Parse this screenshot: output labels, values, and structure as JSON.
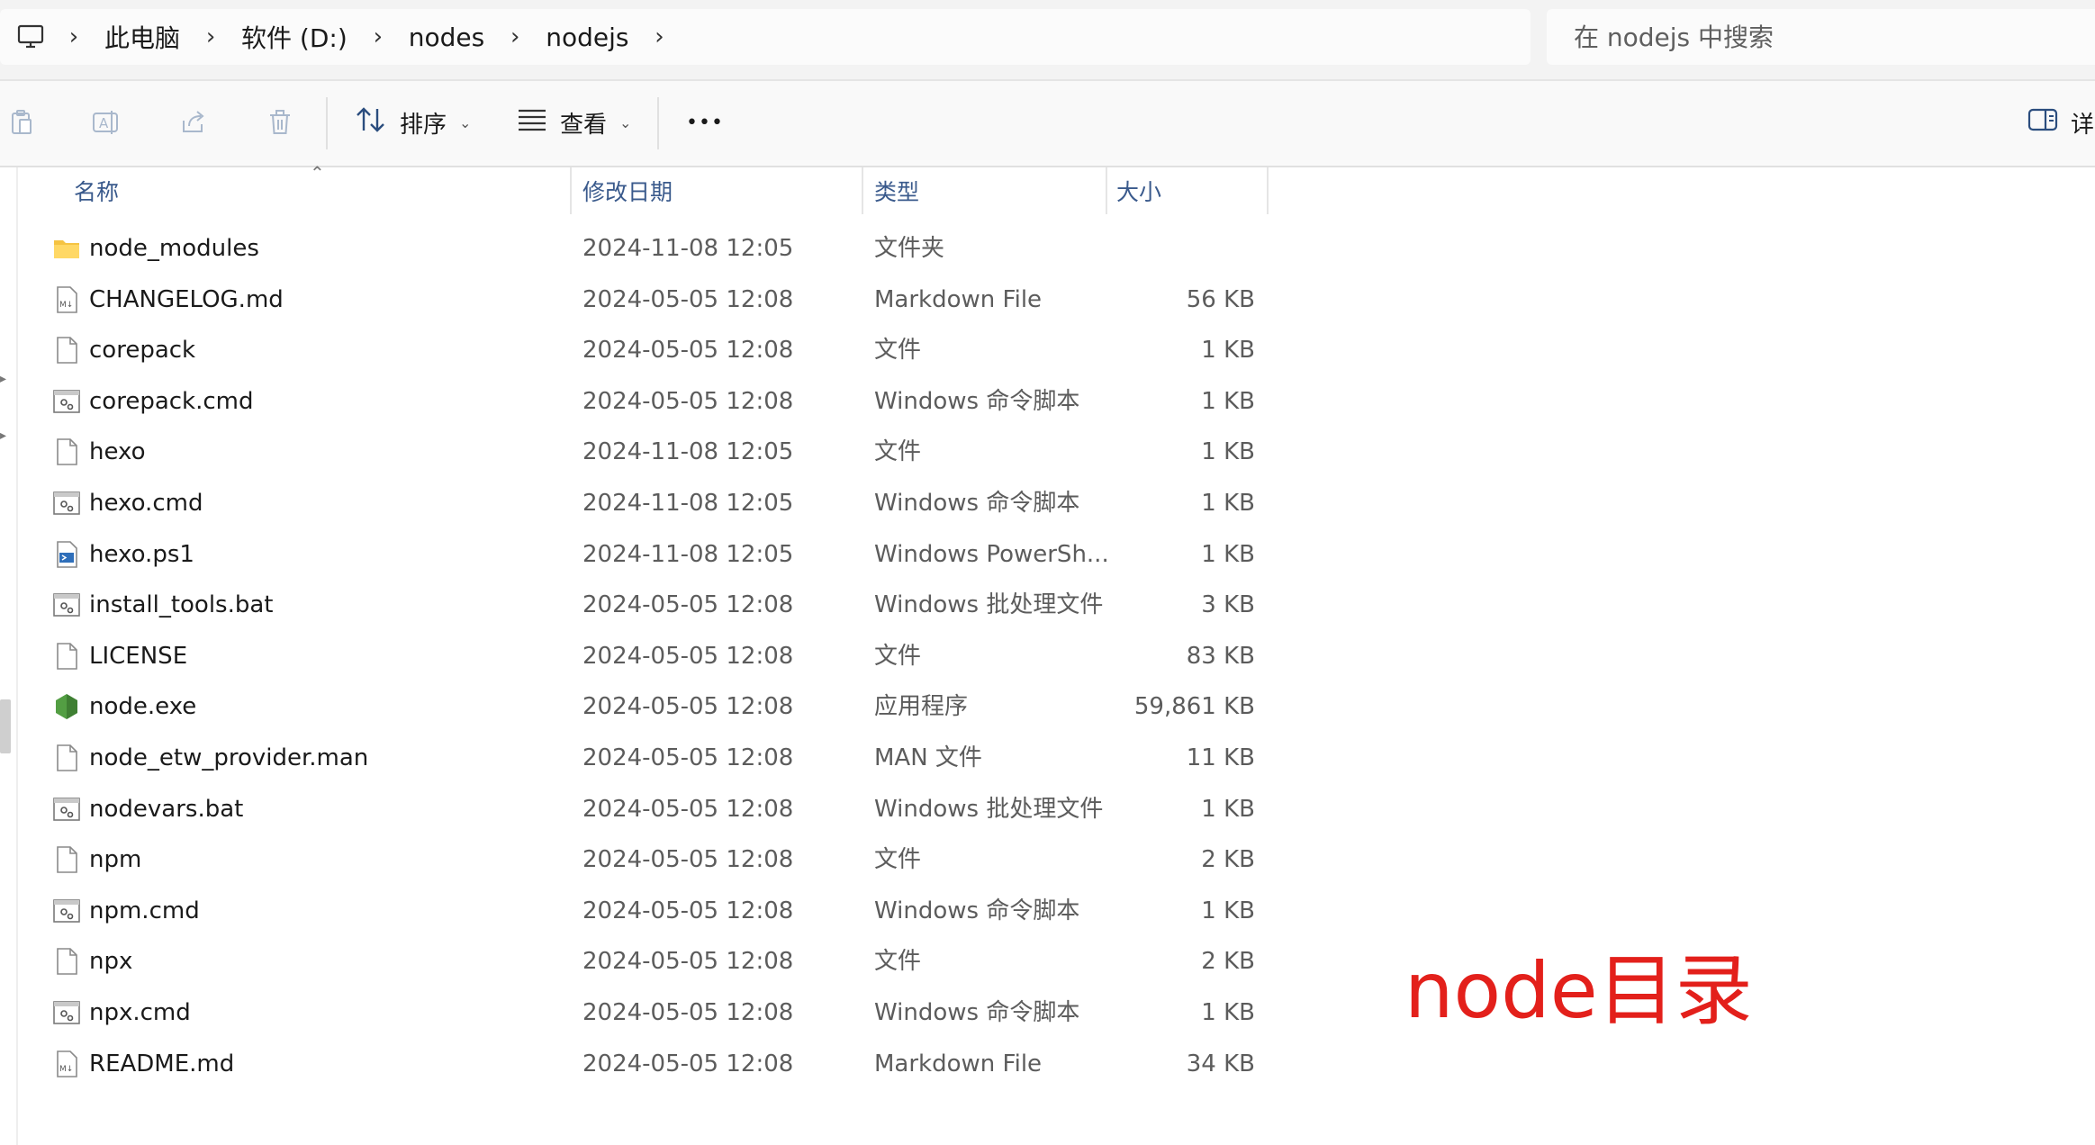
{
  "address": {
    "crumbs": [
      "此电脑",
      "软件 (D:)",
      "nodes",
      "nodejs"
    ]
  },
  "search": {
    "placeholder": "在 nodejs 中搜索"
  },
  "commandbar": {
    "sort_label": "排序",
    "view_label": "查看",
    "more_label": "•••",
    "details_label": "详"
  },
  "columns": {
    "name": "名称",
    "date": "修改日期",
    "type": "类型",
    "size": "大小"
  },
  "files": [
    {
      "name": "node_modules",
      "date": "2024-11-08 12:05",
      "type": "文件夹",
      "size": "",
      "icon": "folder-icon"
    },
    {
      "name": "CHANGELOG.md",
      "date": "2024-05-05 12:08",
      "type": "Markdown File",
      "size": "56 KB",
      "icon": "markdown-file-icon"
    },
    {
      "name": "corepack",
      "date": "2024-05-05 12:08",
      "type": "文件",
      "size": "1 KB",
      "icon": "file-icon"
    },
    {
      "name": "corepack.cmd",
      "date": "2024-05-05 12:08",
      "type": "Windows 命令脚本",
      "size": "1 KB",
      "icon": "script-file-icon"
    },
    {
      "name": "hexo",
      "date": "2024-11-08 12:05",
      "type": "文件",
      "size": "1 KB",
      "icon": "file-icon"
    },
    {
      "name": "hexo.cmd",
      "date": "2024-11-08 12:05",
      "type": "Windows 命令脚本",
      "size": "1 KB",
      "icon": "script-file-icon"
    },
    {
      "name": "hexo.ps1",
      "date": "2024-11-08 12:05",
      "type": "Windows PowerSh...",
      "size": "1 KB",
      "icon": "powershell-file-icon"
    },
    {
      "name": "install_tools.bat",
      "date": "2024-05-05 12:08",
      "type": "Windows 批处理文件",
      "size": "3 KB",
      "icon": "script-file-icon"
    },
    {
      "name": "LICENSE",
      "date": "2024-05-05 12:08",
      "type": "文件",
      "size": "83 KB",
      "icon": "file-icon"
    },
    {
      "name": "node.exe",
      "date": "2024-05-05 12:08",
      "type": "应用程序",
      "size": "59,861 KB",
      "icon": "nodejs-icon"
    },
    {
      "name": "node_etw_provider.man",
      "date": "2024-05-05 12:08",
      "type": "MAN 文件",
      "size": "11 KB",
      "icon": "file-icon"
    },
    {
      "name": "nodevars.bat",
      "date": "2024-05-05 12:08",
      "type": "Windows 批处理文件",
      "size": "1 KB",
      "icon": "script-file-icon"
    },
    {
      "name": "npm",
      "date": "2024-05-05 12:08",
      "type": "文件",
      "size": "2 KB",
      "icon": "file-icon"
    },
    {
      "name": "npm.cmd",
      "date": "2024-05-05 12:08",
      "type": "Windows 命令脚本",
      "size": "1 KB",
      "icon": "script-file-icon"
    },
    {
      "name": "npx",
      "date": "2024-05-05 12:08",
      "type": "文件",
      "size": "2 KB",
      "icon": "file-icon"
    },
    {
      "name": "npx.cmd",
      "date": "2024-05-05 12:08",
      "type": "Windows 命令脚本",
      "size": "1 KB",
      "icon": "script-file-icon"
    },
    {
      "name": "README.md",
      "date": "2024-05-05 12:08",
      "type": "Markdown File",
      "size": "34 KB",
      "icon": "markdown-file-icon"
    }
  ],
  "annotation": {
    "text": "node目录",
    "color": "#e3201b"
  }
}
